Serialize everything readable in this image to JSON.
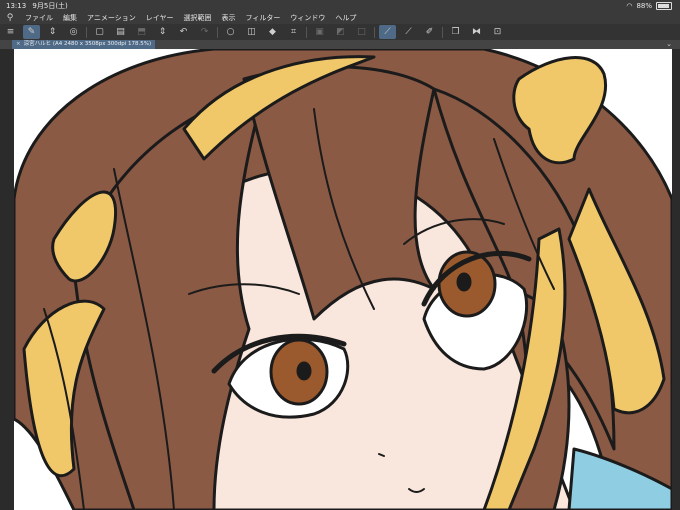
{
  "status": {
    "time": "13:13",
    "date": "9月5日(土)",
    "battery": "88%",
    "battery_level": 0.88
  },
  "menu": [
    "ファイル",
    "編集",
    "アニメーション",
    "レイヤー",
    "選択範囲",
    "表示",
    "フィルター",
    "ウィンドウ",
    "ヘルプ"
  ],
  "tab": {
    "title": "涼宮ハルヒ (A4 2480 x 3508px 300dpi 178.5%)",
    "close": "×"
  },
  "colors": {
    "hair": "#8b5a45",
    "ribbon": "#f0c86a",
    "skin": "#f9e6dc",
    "iris": "#9b5a2e",
    "collar": "#8fcde3",
    "line": "#1b1b1b",
    "accent": "#4f6a86"
  }
}
